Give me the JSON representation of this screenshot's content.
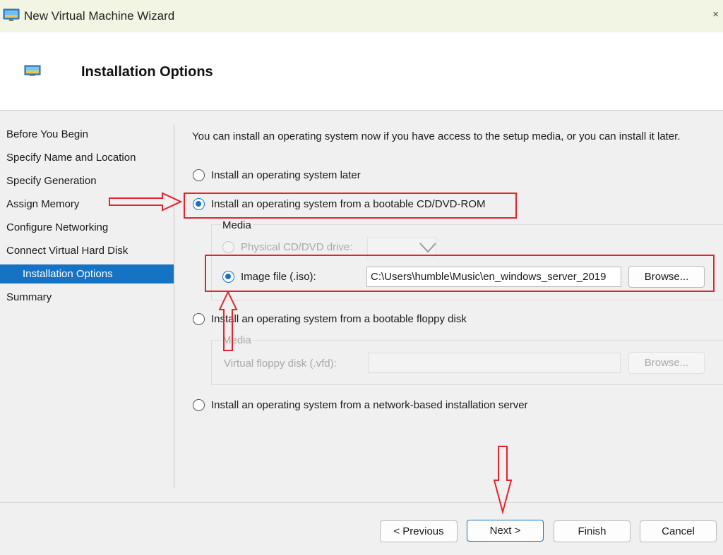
{
  "window": {
    "title": "New Virtual Machine Wizard",
    "close_glyph": "×"
  },
  "header": {
    "title": "Installation Options"
  },
  "sidebar": {
    "items": [
      {
        "label": "Before You Begin"
      },
      {
        "label": "Specify Name and Location"
      },
      {
        "label": "Specify Generation"
      },
      {
        "label": "Assign Memory"
      },
      {
        "label": "Configure Networking"
      },
      {
        "label": "Connect Virtual Hard Disk"
      },
      {
        "label": "Installation Options",
        "active": true
      },
      {
        "label": "Summary"
      }
    ]
  },
  "main": {
    "intro": "You can install an operating system now if you have access to the setup media, or you can install it later.",
    "options": {
      "later": {
        "label": "Install an operating system later",
        "checked": false
      },
      "cd": {
        "label": "Install an operating system from a bootable CD/DVD-ROM",
        "checked": true
      },
      "floppy": {
        "label": "Install an operating system from a bootable floppy disk",
        "checked": false
      },
      "network": {
        "label": "Install an operating system from a network-based installation server",
        "checked": false
      }
    },
    "cd_media": {
      "group_label": "Media",
      "physical_label": "Physical CD/DVD drive:",
      "image_label": "Image file (.iso):",
      "image_value": "C:\\Users\\humble\\Music\\en_windows_server_2019",
      "browse_label": "Browse..."
    },
    "floppy_media": {
      "group_label": "Media",
      "vfd_label": "Virtual floppy disk (.vfd):",
      "browse_label": "Browse..."
    }
  },
  "footer": {
    "previous_label": "< Previous",
    "next_label": "Next >",
    "finish_label": "Finish",
    "cancel_label": "Cancel"
  },
  "colors": {
    "accent": "#1673c4",
    "annotation": "#e3232d",
    "titlebar": "#f2f5e3"
  }
}
